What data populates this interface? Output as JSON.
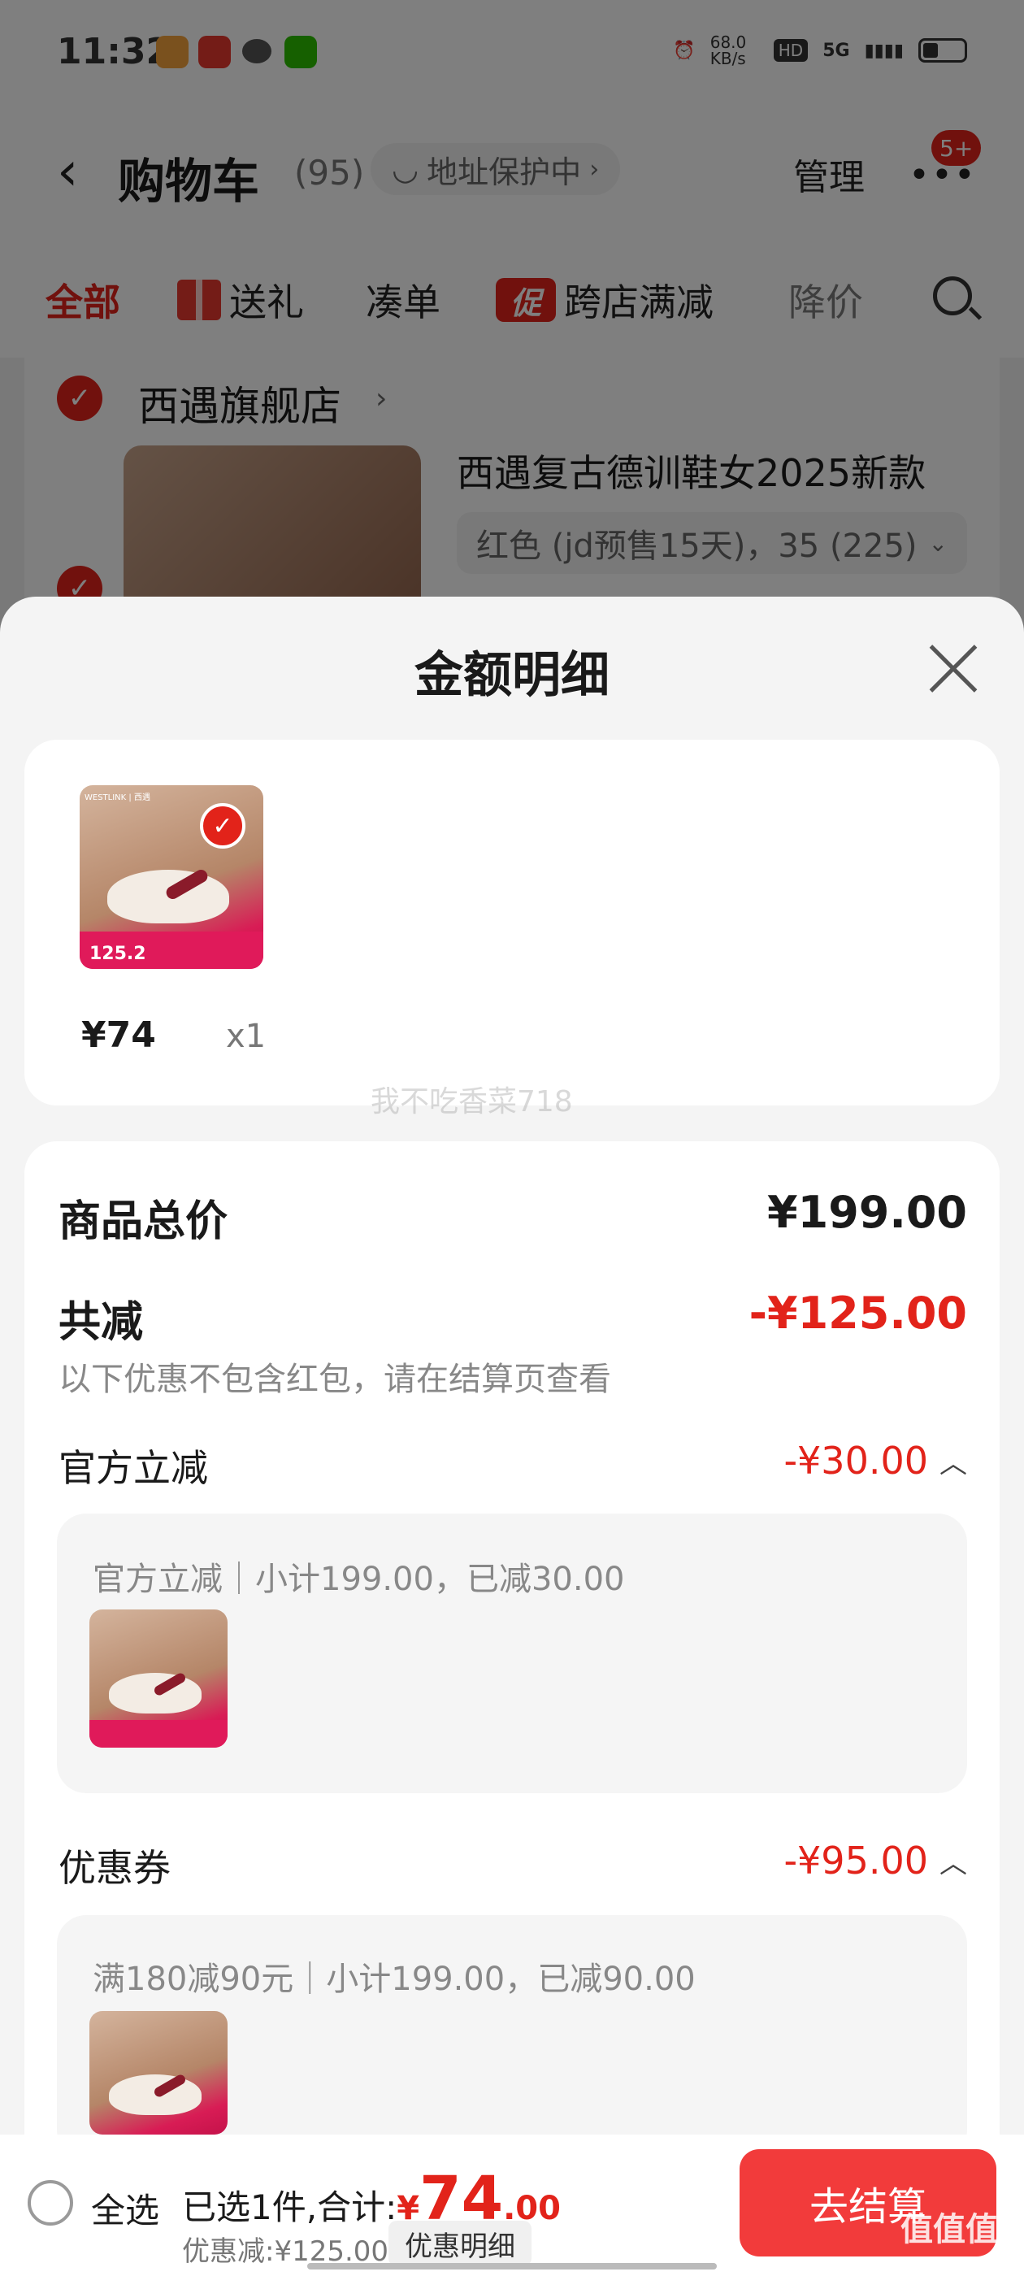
{
  "status_bar": {
    "time": "11:32",
    "net_speed": "68.0 KB/s",
    "hd": "HD",
    "network": "5G"
  },
  "header": {
    "back_icon": "chevron-left-icon",
    "title": "购物车",
    "count": "(95)",
    "address_protection": "地址保护中",
    "manage": "管理",
    "more_badge": "5+"
  },
  "tabs": [
    "全部",
    "送礼",
    "凑单",
    "跨店满减",
    "降价"
  ],
  "tab_badge_cu": "促",
  "store": {
    "name": "西遇旗舰店",
    "product_title": "西遇复古德训鞋女2025新款",
    "sku": "红色 (jd预售15天)，35 (225)"
  },
  "sheet": {
    "title": "金额明细",
    "item": {
      "price": "¥74",
      "qty": "x1",
      "thumb_brand": "WESTLINK | 西遇",
      "thumb_price": "125.2"
    },
    "watermark": "我不吃香菜718",
    "goods_total_label": "商品总价",
    "goods_total": "¥199.00",
    "reduce_label": "共减",
    "reduce_value": "-¥125.00",
    "reduce_note": "以下优惠不包含红包，请在结算页查看",
    "official": {
      "label": "官方立减",
      "value": "-¥30.00",
      "detail": "官方立减｜小计199.00，已减30.00"
    },
    "coupon": {
      "label": "优惠券",
      "value": "-¥95.00",
      "detail": "满180减90元｜小计199.00，已减90.00"
    }
  },
  "bottom_bar": {
    "select_all": "全选",
    "selected_prefix": "已选1件,合计:",
    "currency": "¥",
    "total_int": "74",
    "total_dec": ".00",
    "discount": "优惠减:¥125.00",
    "detail_button": "优惠明细",
    "checkout": "去结算",
    "corner_mark": "值值值"
  },
  "colors": {
    "accent_red": "#e2231a",
    "checkout_red": "#f23b3b"
  }
}
